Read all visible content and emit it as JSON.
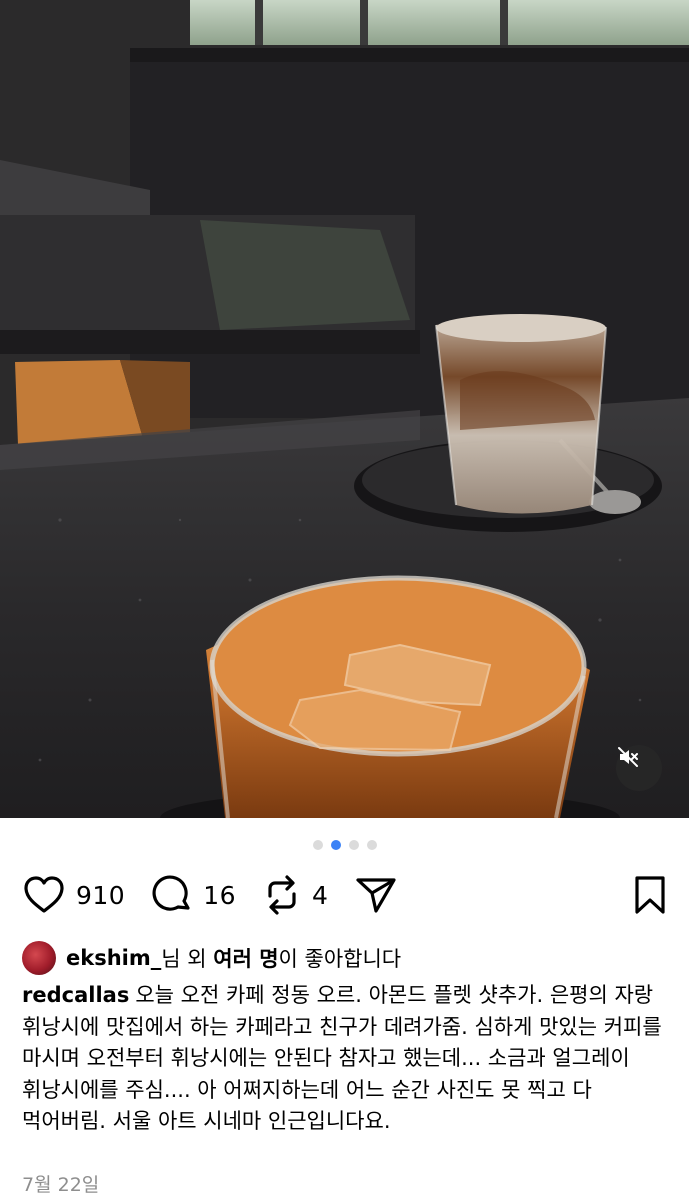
{
  "post": {
    "carousel": {
      "total": 4,
      "active_index": 1
    },
    "actions": {
      "like_count": "910",
      "comment_count": "16",
      "repost_count": "4"
    },
    "likes_line": {
      "user": "ekshim_",
      "suffix_1": "님 외 ",
      "others": "여러 명",
      "suffix_2": "이 좋아합니다"
    },
    "caption": {
      "username": "redcallas",
      "text": "오늘 오전 카페 정동 오르. 아몬드 플렛 샷추가. 은평의 자랑 휘낭시에 맛집에서 하는 카페라고 친구가 데려가줌. 심하게 맛있는 커피를 마시며 오전부터 휘낭시에는 안된다 참자고 했는데... 소금과 얼그레이 휘낭시에를 주심.... 아 어쩌지하는데 어느 순간 사진도 못 찍고 다 먹어버림. 서울 아트 시네마 인근입니다요."
    },
    "date": "7월 22일"
  },
  "colors": {
    "active_dot": "#3b82f6",
    "inactive_dot": "#dbdbdb",
    "muted_text": "#8e8e8e"
  },
  "icons": [
    "heart-icon",
    "comment-icon",
    "repost-icon",
    "share-icon",
    "bookmark-icon",
    "mute-icon"
  ]
}
